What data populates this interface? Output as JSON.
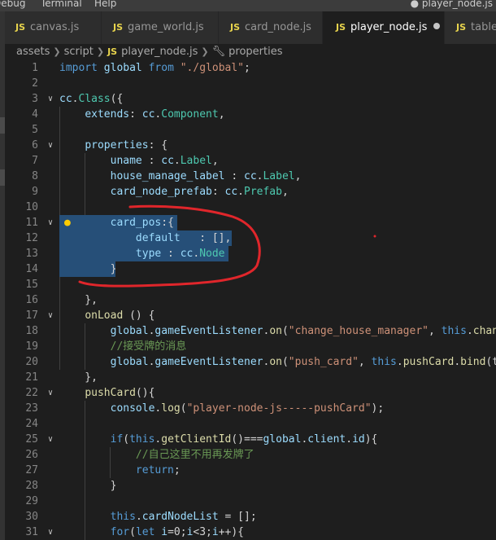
{
  "menubar": {
    "items": [
      "Debug",
      "Terminal",
      "Help"
    ],
    "window_title": "● player_node.js"
  },
  "tabs": [
    {
      "badge": "JS",
      "label": "canvas.js",
      "active": false
    },
    {
      "badge": "JS",
      "label": "game_world.js",
      "active": false
    },
    {
      "badge": "JS",
      "label": "card_node.js",
      "active": false
    },
    {
      "badge": "JS",
      "label": "player_node.js",
      "active": true,
      "modified": true
    },
    {
      "badge": "JS",
      "label": "table_",
      "active": false
    }
  ],
  "breadcrumb": {
    "items": [
      "assets",
      "script",
      "player_node.js",
      "properties"
    ],
    "file_badge": "JS",
    "symbol_icon": "wrench-icon"
  },
  "colors": {
    "keyword": "#569cd6",
    "string": "#ce9178",
    "property": "#9cdcfe",
    "class": "#4ec9b0",
    "function": "#dcdcaa",
    "comment": "#6a9955",
    "selection": "#264f78",
    "annotation": "#e0262b",
    "lightbulb": "#ffcc00"
  },
  "editor": {
    "lines": [
      {
        "n": "1",
        "t": [
          [
            "kw",
            "import"
          ],
          [
            "",
            " "
          ],
          [
            "prop",
            "global"
          ],
          [
            "",
            " "
          ],
          [
            "kw",
            "from"
          ],
          [
            "",
            " "
          ],
          [
            "str",
            "\"./global\""
          ],
          [
            "",
            ";"
          ]
        ]
      },
      {
        "n": "2",
        "t": []
      },
      {
        "n": "3",
        "t": [
          [
            "prop",
            "cc"
          ],
          [
            "",
            "."
          ],
          [
            "cls",
            "Class"
          ],
          [
            "",
            "({"
          ]
        ]
      },
      {
        "n": "4",
        "t": [
          [
            "",
            "    "
          ],
          [
            "prop",
            "extends"
          ],
          [
            "",
            ": "
          ],
          [
            "prop",
            "cc"
          ],
          [
            "",
            "."
          ],
          [
            "cls",
            "Component"
          ],
          [
            "",
            ","
          ]
        ]
      },
      {
        "n": "5",
        "t": []
      },
      {
        "n": "6",
        "t": [
          [
            "",
            "    "
          ],
          [
            "prop",
            "properties"
          ],
          [
            "",
            ": {"
          ]
        ]
      },
      {
        "n": "7",
        "t": [
          [
            "",
            "        "
          ],
          [
            "prop",
            "uname"
          ],
          [
            "",
            " : "
          ],
          [
            "prop",
            "cc"
          ],
          [
            "",
            "."
          ],
          [
            "cls",
            "Label"
          ],
          [
            "",
            ","
          ]
        ]
      },
      {
        "n": "8",
        "t": [
          [
            "",
            "        "
          ],
          [
            "prop",
            "house_manage_label"
          ],
          [
            "",
            " : "
          ],
          [
            "prop",
            "cc"
          ],
          [
            "",
            "."
          ],
          [
            "cls",
            "Label"
          ],
          [
            "",
            ","
          ]
        ]
      },
      {
        "n": "9",
        "t": [
          [
            "",
            "        "
          ],
          [
            "prop",
            "card_node_prefab"
          ],
          [
            "",
            ": "
          ],
          [
            "prop",
            "cc"
          ],
          [
            "",
            "."
          ],
          [
            "cls",
            "Prefab"
          ],
          [
            "",
            ","
          ]
        ]
      },
      {
        "n": "10",
        "t": []
      },
      {
        "n": "11",
        "t": [
          [
            "",
            "        "
          ],
          [
            "prop",
            "card_pos"
          ],
          [
            "",
            ":{"
          ]
        ]
      },
      {
        "n": "12",
        "t": [
          [
            "",
            "            "
          ],
          [
            "prop",
            "default"
          ],
          [
            "",
            "   : [],"
          ]
        ]
      },
      {
        "n": "13",
        "t": [
          [
            "",
            "            "
          ],
          [
            "prop",
            "type"
          ],
          [
            "",
            " : "
          ],
          [
            "prop",
            "cc"
          ],
          [
            "",
            "."
          ],
          [
            "cls",
            "Node"
          ]
        ]
      },
      {
        "n": "14",
        "t": [
          [
            "",
            "        }"
          ]
        ]
      },
      {
        "n": "15",
        "t": []
      },
      {
        "n": "16",
        "t": [
          [
            "",
            "    },"
          ]
        ]
      },
      {
        "n": "17",
        "t": [
          [
            "",
            "    "
          ],
          [
            "fn",
            "onLoad"
          ],
          [
            "",
            " () {"
          ]
        ]
      },
      {
        "n": "18",
        "t": [
          [
            "",
            "        "
          ],
          [
            "prop",
            "global"
          ],
          [
            "",
            "."
          ],
          [
            "prop",
            "gameEventListener"
          ],
          [
            "",
            "."
          ],
          [
            "fn",
            "on"
          ],
          [
            "",
            "("
          ],
          [
            "str",
            "\"change_house_manager\""
          ],
          [
            "",
            ", "
          ],
          [
            "kw",
            "this"
          ],
          [
            "",
            "."
          ],
          [
            "fn",
            "chang"
          ]
        ]
      },
      {
        "n": "19",
        "t": [
          [
            "",
            "        "
          ],
          [
            "cmt",
            "//接受牌的消息"
          ]
        ]
      },
      {
        "n": "20",
        "t": [
          [
            "",
            "        "
          ],
          [
            "prop",
            "global"
          ],
          [
            "",
            "."
          ],
          [
            "prop",
            "gameEventListener"
          ],
          [
            "",
            "."
          ],
          [
            "fn",
            "on"
          ],
          [
            "",
            "("
          ],
          [
            "str",
            "\"push_card\""
          ],
          [
            "",
            ", "
          ],
          [
            "kw",
            "this"
          ],
          [
            "",
            "."
          ],
          [
            "fn",
            "pushCard"
          ],
          [
            "",
            "."
          ],
          [
            "fn",
            "bind"
          ],
          [
            "",
            "(th"
          ]
        ]
      },
      {
        "n": "21",
        "t": [
          [
            "",
            "    },"
          ]
        ]
      },
      {
        "n": "22",
        "t": [
          [
            "",
            "    "
          ],
          [
            "fn",
            "pushCard"
          ],
          [
            "",
            "(){"
          ]
        ]
      },
      {
        "n": "23",
        "t": [
          [
            "",
            "        "
          ],
          [
            "prop",
            "console"
          ],
          [
            "",
            "."
          ],
          [
            "fn",
            "log"
          ],
          [
            "",
            "("
          ],
          [
            "str",
            "\"player-node-js-----pushCard\""
          ],
          [
            "",
            ");"
          ]
        ]
      },
      {
        "n": "24",
        "t": []
      },
      {
        "n": "25",
        "t": [
          [
            "",
            "        "
          ],
          [
            "kw",
            "if"
          ],
          [
            "",
            "("
          ],
          [
            "kw",
            "this"
          ],
          [
            "",
            "."
          ],
          [
            "fn",
            "getClientId"
          ],
          [
            "",
            "()==="
          ],
          [
            "prop",
            "global"
          ],
          [
            "",
            "."
          ],
          [
            "prop",
            "client"
          ],
          [
            "",
            "."
          ],
          [
            "prop",
            "id"
          ],
          [
            "",
            "){"
          ]
        ]
      },
      {
        "n": "26",
        "t": [
          [
            "",
            "            "
          ],
          [
            "cmt",
            "//自己这里不用再发牌了"
          ]
        ]
      },
      {
        "n": "27",
        "t": [
          [
            "",
            "            "
          ],
          [
            "kw",
            "return"
          ],
          [
            "",
            ";"
          ]
        ]
      },
      {
        "n": "28",
        "t": [
          [
            "",
            "        }"
          ]
        ]
      },
      {
        "n": "29",
        "t": []
      },
      {
        "n": "30",
        "t": [
          [
            "",
            "        "
          ],
          [
            "kw",
            "this"
          ],
          [
            "",
            "."
          ],
          [
            "prop",
            "cardNodeList"
          ],
          [
            "",
            " = [];"
          ]
        ]
      },
      {
        "n": "31",
        "t": [
          [
            "",
            "        "
          ],
          [
            "kw",
            "for"
          ],
          [
            "",
            "("
          ],
          [
            "kw",
            "let"
          ],
          [
            "",
            " "
          ],
          [
            "prop",
            "i"
          ],
          [
            "",
            "=0;"
          ],
          [
            "prop",
            "i"
          ],
          [
            "",
            "<3;"
          ],
          [
            "prop",
            "i"
          ],
          [
            "",
            "++){"
          ]
        ]
      }
    ],
    "fold_lines": [
      "3",
      "6",
      "11",
      "17",
      "22",
      "25",
      "31"
    ],
    "selected_lines": [
      "11",
      "12",
      "13",
      "14"
    ],
    "lightbulb_line": "11"
  }
}
